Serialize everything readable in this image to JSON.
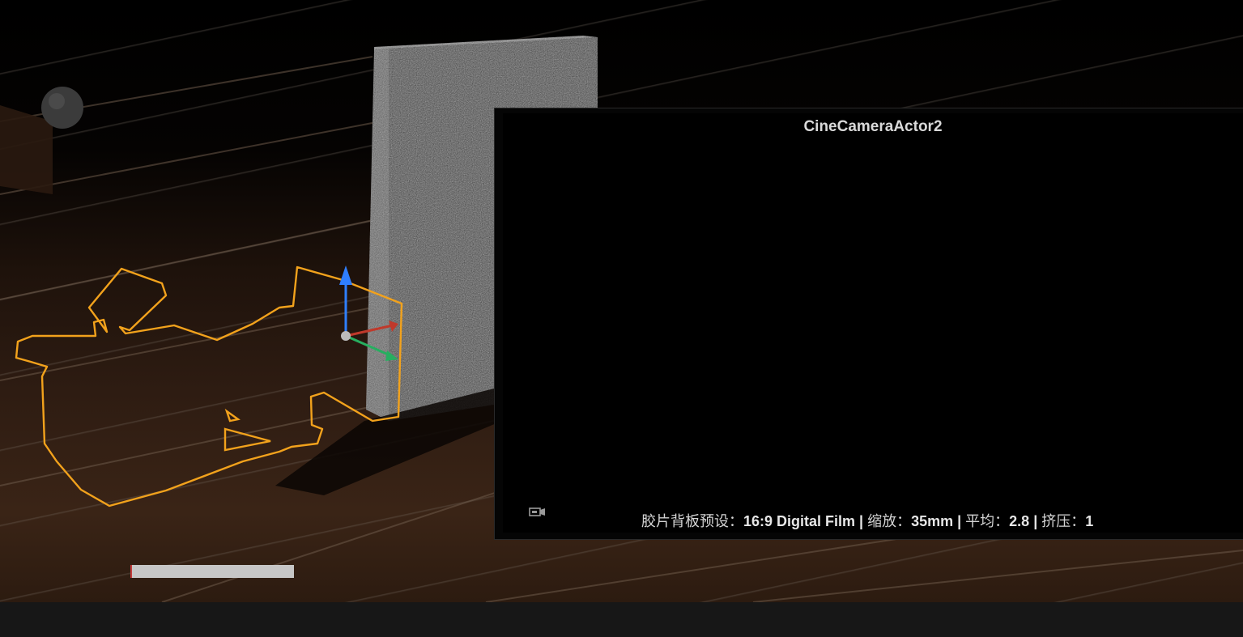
{
  "viewport": {
    "pip": {
      "title": "CineCameraActor2",
      "info": {
        "preset_label": "胶片背板预设：",
        "preset_value": "16:9 Digital Film",
        "sep1": " | ",
        "zoom_label": "缩放：",
        "zoom_value": "35mm",
        "sep2": " | ",
        "aperture_label": "平均：",
        "aperture_value": "2.8",
        "sep3": " | ",
        "squeeze_label": "挤压：",
        "squeeze_value": "1"
      },
      "icon": "camera-icon"
    },
    "selection_color": "#f2a21c",
    "progress": {
      "fraction": 1.0
    }
  },
  "colors": {
    "axis_z": "#2f7fff",
    "axis_x": "#c0392b",
    "axis_y": "#27ae60"
  }
}
